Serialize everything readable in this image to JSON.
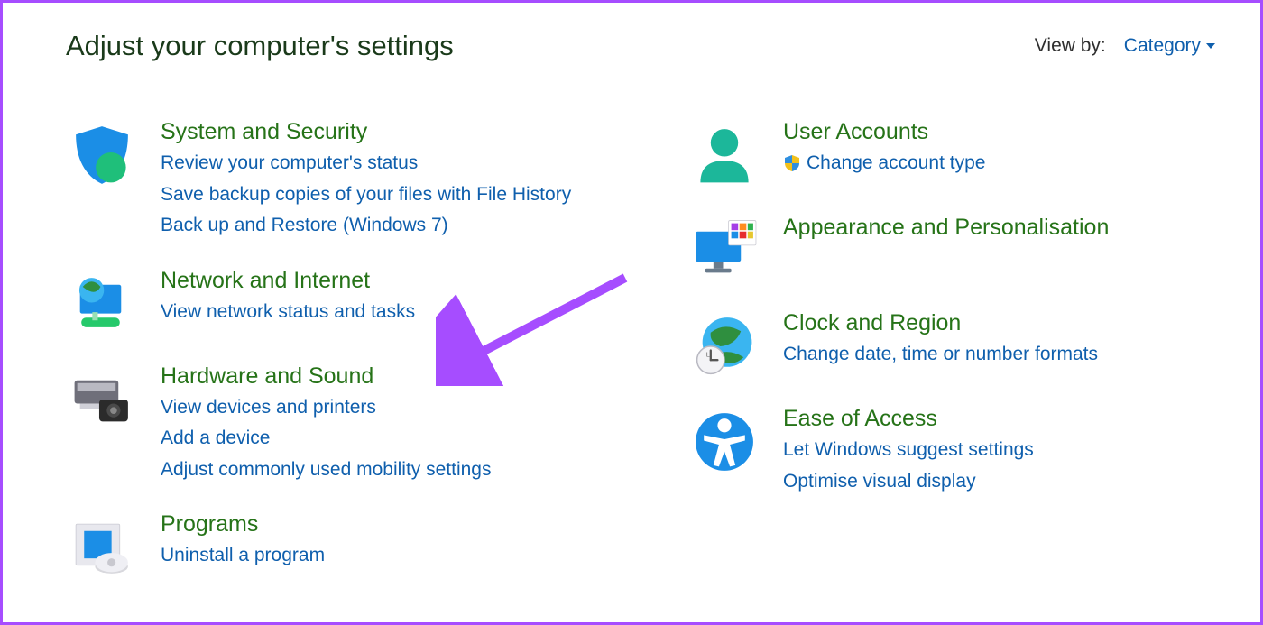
{
  "header": {
    "title": "Adjust your computer's settings",
    "view_by_label": "View by:",
    "view_by_value": "Category"
  },
  "categories": {
    "system": {
      "title": "System and Security",
      "links": [
        "Review your computer's status",
        "Save backup copies of your files with File History",
        "Back up and Restore (Windows 7)"
      ]
    },
    "network": {
      "title": "Network and Internet",
      "links": [
        "View network status and tasks"
      ]
    },
    "hardware": {
      "title": "Hardware and Sound",
      "links": [
        "View devices and printers",
        "Add a device",
        "Adjust commonly used mobility settings"
      ]
    },
    "programs": {
      "title": "Programs",
      "links": [
        "Uninstall a program"
      ]
    },
    "users": {
      "title": "User Accounts",
      "links": [
        "Change account type"
      ]
    },
    "appearance": {
      "title": "Appearance and Personalisation",
      "links": []
    },
    "clock": {
      "title": "Clock and Region",
      "links": [
        "Change date, time or number formats"
      ]
    },
    "ease": {
      "title": "Ease of Access",
      "links": [
        "Let Windows suggest settings",
        "Optimise visual display"
      ]
    }
  }
}
